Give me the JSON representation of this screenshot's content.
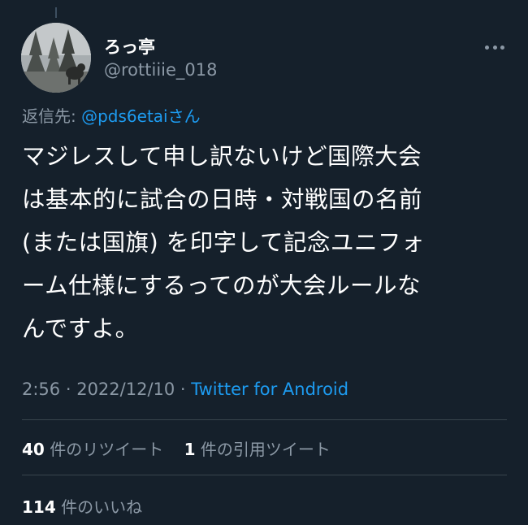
{
  "author": {
    "display_name": "ろっ亭",
    "handle": "@rottiiie_018"
  },
  "reply_to": {
    "prefix": "返信先: ",
    "mention": "@pds6etai",
    "suffix": "さん"
  },
  "tweet": {
    "lines": [
      "マジレスして申し訳ないけど国際大会",
      "は基本的に試合の日時・対戦国の名前",
      "(または国旗) を印字して記念ユニフォ",
      "ーム仕様にするってのが大会ルールな",
      "んですよ。"
    ]
  },
  "meta": {
    "time": "2:56",
    "sep1": " · ",
    "date": "2022/12/10",
    "sep2": " · ",
    "source": "Twitter for Android"
  },
  "stats": {
    "retweets_count": "40",
    "retweets_label": "件のリツイート",
    "quotes_count": "1",
    "quotes_label": "件の引用ツイート",
    "likes_count": "114",
    "likes_label": "件のいいね"
  },
  "colors": {
    "background": "#15202b",
    "secondary_text": "#8b98a5",
    "accent": "#1d9bf0",
    "divider": "#38444d"
  },
  "icons": {
    "more": "more-horizontal-icon"
  }
}
